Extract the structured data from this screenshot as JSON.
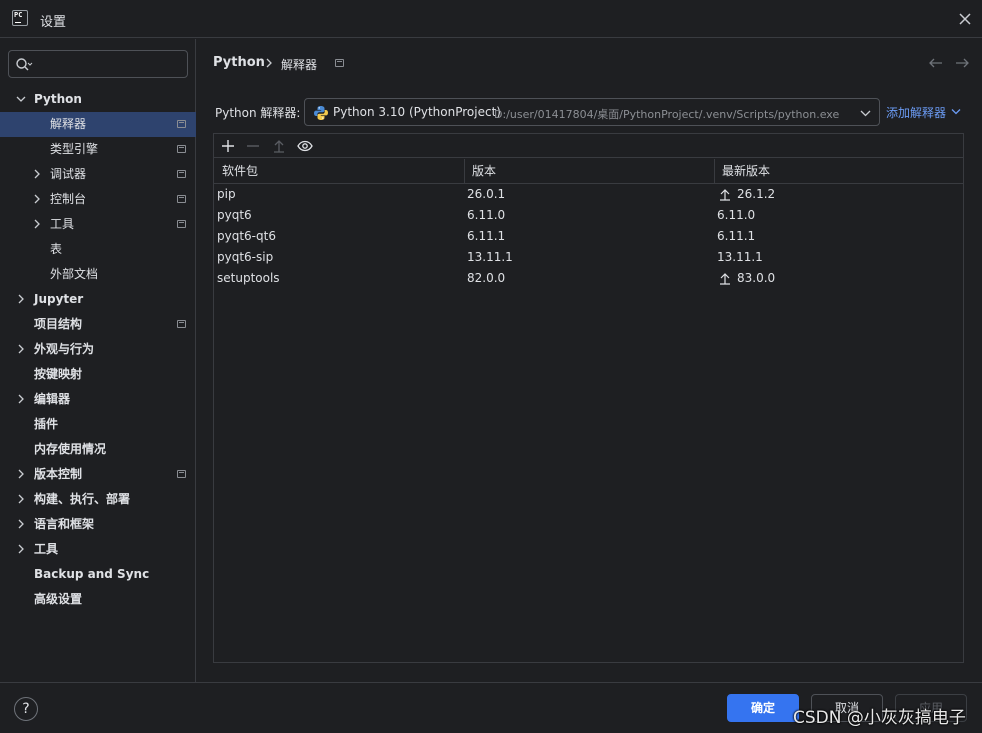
{
  "window": {
    "title": "设置",
    "logo_text": "PC"
  },
  "sidebar": {
    "search": {
      "placeholder": "",
      "value": ""
    },
    "items": [
      {
        "label": "Python",
        "bold": true,
        "expanded": true
      },
      {
        "label": "解释器",
        "selected": true,
        "project": true
      },
      {
        "label": "类型引擎",
        "project": true
      },
      {
        "label": "调试器",
        "project": true,
        "collapsed": true
      },
      {
        "label": "控制台",
        "project": true,
        "collapsed": true
      },
      {
        "label": "工具",
        "project": true,
        "collapsed": true
      },
      {
        "label": "表"
      },
      {
        "label": "外部文档"
      },
      {
        "label": "Jupyter",
        "bold": true,
        "collapsed": true
      },
      {
        "label": "项目结构",
        "bold": true,
        "project": true
      },
      {
        "label": "外观与行为",
        "bold": true,
        "collapsed": true
      },
      {
        "label": "按键映射",
        "bold": true
      },
      {
        "label": "编辑器",
        "bold": true,
        "collapsed": true
      },
      {
        "label": "插件",
        "bold": true
      },
      {
        "label": "内存使用情况",
        "bold": true
      },
      {
        "label": "版本控制",
        "bold": true,
        "collapsed": true,
        "project": true
      },
      {
        "label": "构建、执行、部署",
        "bold": true,
        "collapsed": true
      },
      {
        "label": "语言和框架",
        "bold": true,
        "collapsed": true
      },
      {
        "label": "工具",
        "bold": true,
        "collapsed": true
      },
      {
        "label": "Backup and Sync",
        "bold": true
      },
      {
        "label": "高级设置",
        "bold": true
      }
    ]
  },
  "breadcrumb": {
    "root": "Python",
    "current": "解释器"
  },
  "interpreter": {
    "label": "Python 解释器:",
    "selected_name": "Python 3.10 (PythonProject)",
    "selected_path": "D:/user/01417804/桌面/PythonProject/.venv/Scripts/python.exe",
    "add_label": "添加解释器"
  },
  "packages": {
    "columns": [
      "软件包",
      "版本",
      "最新版本"
    ],
    "rows": [
      {
        "name": "pip",
        "version": "26.0.1",
        "latest": "26.1.2",
        "upgrade": true
      },
      {
        "name": "pyqt6",
        "version": "6.11.0",
        "latest": "6.11.0",
        "upgrade": false
      },
      {
        "name": "pyqt6-qt6",
        "version": "6.11.1",
        "latest": "6.11.1",
        "upgrade": false
      },
      {
        "name": "pyqt6-sip",
        "version": "13.11.1",
        "latest": "13.11.1",
        "upgrade": false
      },
      {
        "name": "setuptools",
        "version": "82.0.0",
        "latest": "83.0.0",
        "upgrade": true
      }
    ]
  },
  "footer": {
    "help": "?",
    "ok": "确定",
    "cancel": "取消",
    "apply": "应用",
    "watermark": "CSDN @小灰灰搞电子"
  },
  "colors": {
    "background": "#1e1f22",
    "selection": "#2e436e",
    "accent": "#3574f0",
    "link": "#6b9bf4",
    "border": "#393b40"
  },
  "icons": {
    "logo": "pycharm-logo-icon",
    "close": "close-icon",
    "search": "search-icon",
    "add": "plus-icon",
    "remove": "minus-icon",
    "upgrade": "upgrade-arrow-icon",
    "show": "eye-icon",
    "interpreter": "python-logo-icon"
  }
}
